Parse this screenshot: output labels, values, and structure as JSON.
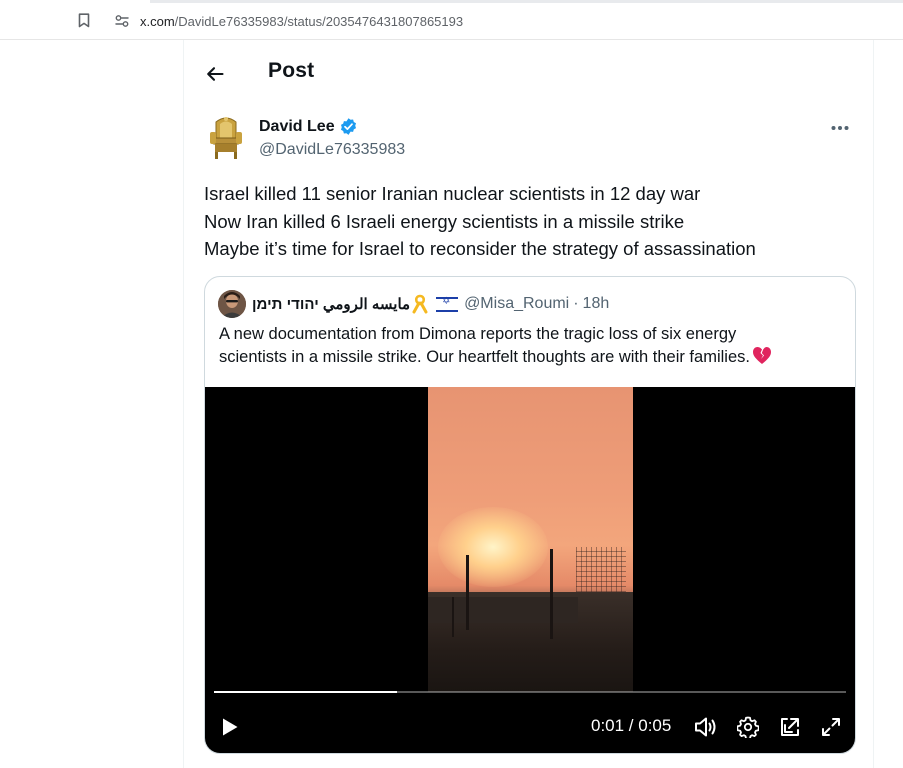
{
  "browser": {
    "url_host": "x.com",
    "url_path": "/DavidLe76335983/status/2035476431807865193"
  },
  "header": {
    "title": "Post"
  },
  "post": {
    "author_name": "David Lee",
    "author_handle": "@DavidLe76335983",
    "text_lines": [
      "Israel killed 11 senior Iranian nuclear scientists in 12 day war",
      "Now Iran killed 6 Israeli energy scientists in a missile strike",
      "Maybe it’s time for Israel to reconsider the strategy of assassination"
    ]
  },
  "quote": {
    "author_name": "مايسه الرومي יהודי תימן",
    "author_handle": "@Misa_Roumi",
    "separator": "·",
    "time": "18h",
    "text_lines": [
      "A new documentation from Dimona reports the tragic loss of six energy",
      "scientists in a missile strike. Our heartfelt thoughts are with their families."
    ],
    "video": {
      "time_readout": "0:01 / 0:05",
      "progress": 0.29
    }
  },
  "icons": {
    "bookmark": "bookmark-icon",
    "site_info": "site-info-icon",
    "back": "back-arrow-icon",
    "verified": "verified-badge-icon",
    "more": "more-icon",
    "ribbon": "yellow-ribbon-icon",
    "flag": "israel-flag-icon",
    "heart": "broken-heart-icon",
    "play": "play-icon",
    "volume": "volume-icon",
    "settings": "gear-icon",
    "pip": "picture-in-picture-icon",
    "fullscreen": "fullscreen-icon"
  },
  "colors": {
    "verified": "#1d9bf0",
    "text_primary": "#0f1419",
    "text_secondary": "#536471",
    "border": "#cfd9de",
    "broken_heart": "#e0245e"
  }
}
